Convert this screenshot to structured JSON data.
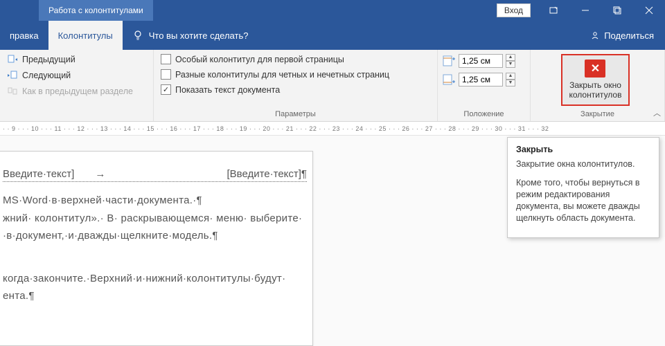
{
  "titlebar": {
    "context_tab": "Работа с колонтитулами",
    "login": "Вход"
  },
  "tabs": {
    "left": "правка",
    "active": "Колонтитулы",
    "tellme": "Что вы хотите сделать?",
    "share": "Поделиться"
  },
  "ribbon": {
    "nav": {
      "prev": "Предыдущий",
      "next": "Следующий",
      "as_prev": "Как в предыдущем разделе"
    },
    "params": {
      "opt1": "Особый колонтитул для первой страницы",
      "opt2": "Разные колонтитулы для четных и нечетных страниц",
      "opt3": "Показать текст документа",
      "label": "Параметры"
    },
    "pos": {
      "val1": "1,25 см",
      "val2": "1,25 см",
      "label": "Положение"
    },
    "close": {
      "line1": "Закрыть окно",
      "line2": "колонтитулов",
      "label": "Закрытие"
    }
  },
  "ruler": "· · 9 · · · 10 · · · 11 · · · 12 · · · 13 · · · 14 · · · 15 · · · 16 · · · 17 · · · 18 · · · 19 · · · 20 · · · 21 · · · 22 · · · 23 · · · 24 · · · 25 · · · 26 · · · 27 · · · 28 · · · 29 · · · 30 · · · 31 · · · 32",
  "doc": {
    "field_left": "Введите·текст]",
    "tabchar": "→",
    "field_right": "[Введите·текст]¶",
    "p1": "MS·Word·в·верхней·части·документа.·¶",
    "p2": "жний· колонтитул».· В· раскрывающемся· меню· выберите·",
    "p3": "·в·документ,·и·дважды·щелкните·модель.¶",
    "p4": "когда·закончите.·Верхний·и·нижний·колонтитулы·будут·",
    "p5": "ента.¶"
  },
  "tooltip": {
    "title": "Закрыть",
    "p1": "Закрытие окна колонтитулов.",
    "p2": "Кроме того, чтобы вернуться в режим редактирования документа, вы можете дважды щелкнуть область документа."
  }
}
